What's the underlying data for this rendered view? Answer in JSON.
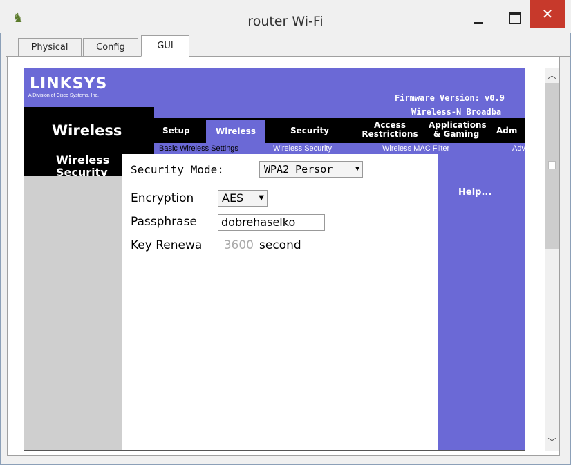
{
  "window": {
    "title": "router Wi-Fi",
    "icon": "router-icon",
    "minimize": "minimize-icon",
    "maximize": "maximize-icon",
    "close_glyph": "✕"
  },
  "tabs": [
    {
      "label": "Physical"
    },
    {
      "label": "Config"
    },
    {
      "label": "GUI",
      "active": true
    }
  ],
  "page": {
    "logo": "LINKSYS",
    "logo_sub": "A Division of Cisco Systems, Inc.",
    "firmware": "Firmware Version: v0.9",
    "product": "Wireless-N Broadba",
    "section_title": "Wireless",
    "nav": {
      "setup": "Setup",
      "wireless": "Wireless",
      "security": "Security",
      "access_line1": "Access",
      "access_line2": "Restrictions",
      "apps_line1": "Applications",
      "apps_line2": "& Gaming",
      "admin": "Adm"
    },
    "subnav": {
      "basic": "Basic Wireless Settings",
      "security": "Wireless Security",
      "mac": "Wireless MAC Filter",
      "adv": "Adv"
    },
    "left_title": "Wireless Security",
    "form": {
      "security_mode_label": "Security Mode:",
      "security_mode_value": "WPA2 Persor",
      "encryption_label": "Encryption",
      "encryption_value": "AES",
      "passphrase_label": "Passphrase",
      "passphrase_value": "dobrehaselko",
      "key_renewal_label": "Key Renewa",
      "key_renewal_value": "3600",
      "key_renewal_unit": "second"
    },
    "help": "Help..."
  },
  "colors": {
    "brand_purple": "#6b69d6",
    "close_red": "#c7392b"
  }
}
